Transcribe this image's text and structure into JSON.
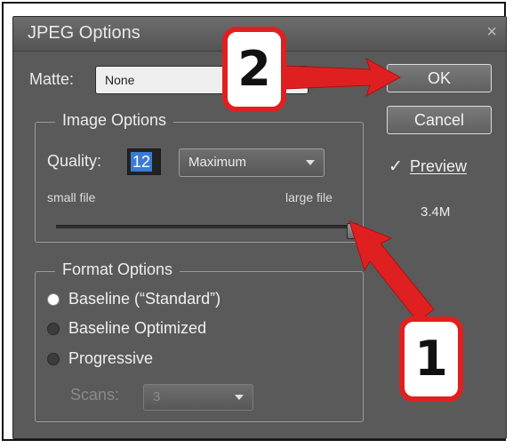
{
  "dialog": {
    "title": "JPEG Options",
    "close_glyph": "×"
  },
  "matte": {
    "label": "Matte:",
    "value": "None"
  },
  "buttons": {
    "ok": "OK",
    "cancel": "Cancel"
  },
  "preview": {
    "checked": true,
    "check_glyph": "✓",
    "label": "Preview",
    "size": "3.4M"
  },
  "image_options": {
    "legend": "Image Options",
    "quality_label": "Quality:",
    "quality_value": "12",
    "quality_preset": "Maximum",
    "slider_min_label": "small file",
    "slider_max_label": "large file",
    "slider_level_fraction": 1.0
  },
  "format_options": {
    "legend": "Format Options",
    "choices": [
      "Baseline (“Standard”)",
      "Baseline Optimized",
      "Progressive"
    ],
    "selected_index": 0,
    "scans_label": "Scans:",
    "scans_value": "3"
  },
  "annotations": {
    "step1": "1",
    "step2": "2",
    "accent_color": "#e02020"
  },
  "colors": {
    "dialog_bg": "#5a5a5a",
    "quality_highlight": "#3a7bd5"
  }
}
